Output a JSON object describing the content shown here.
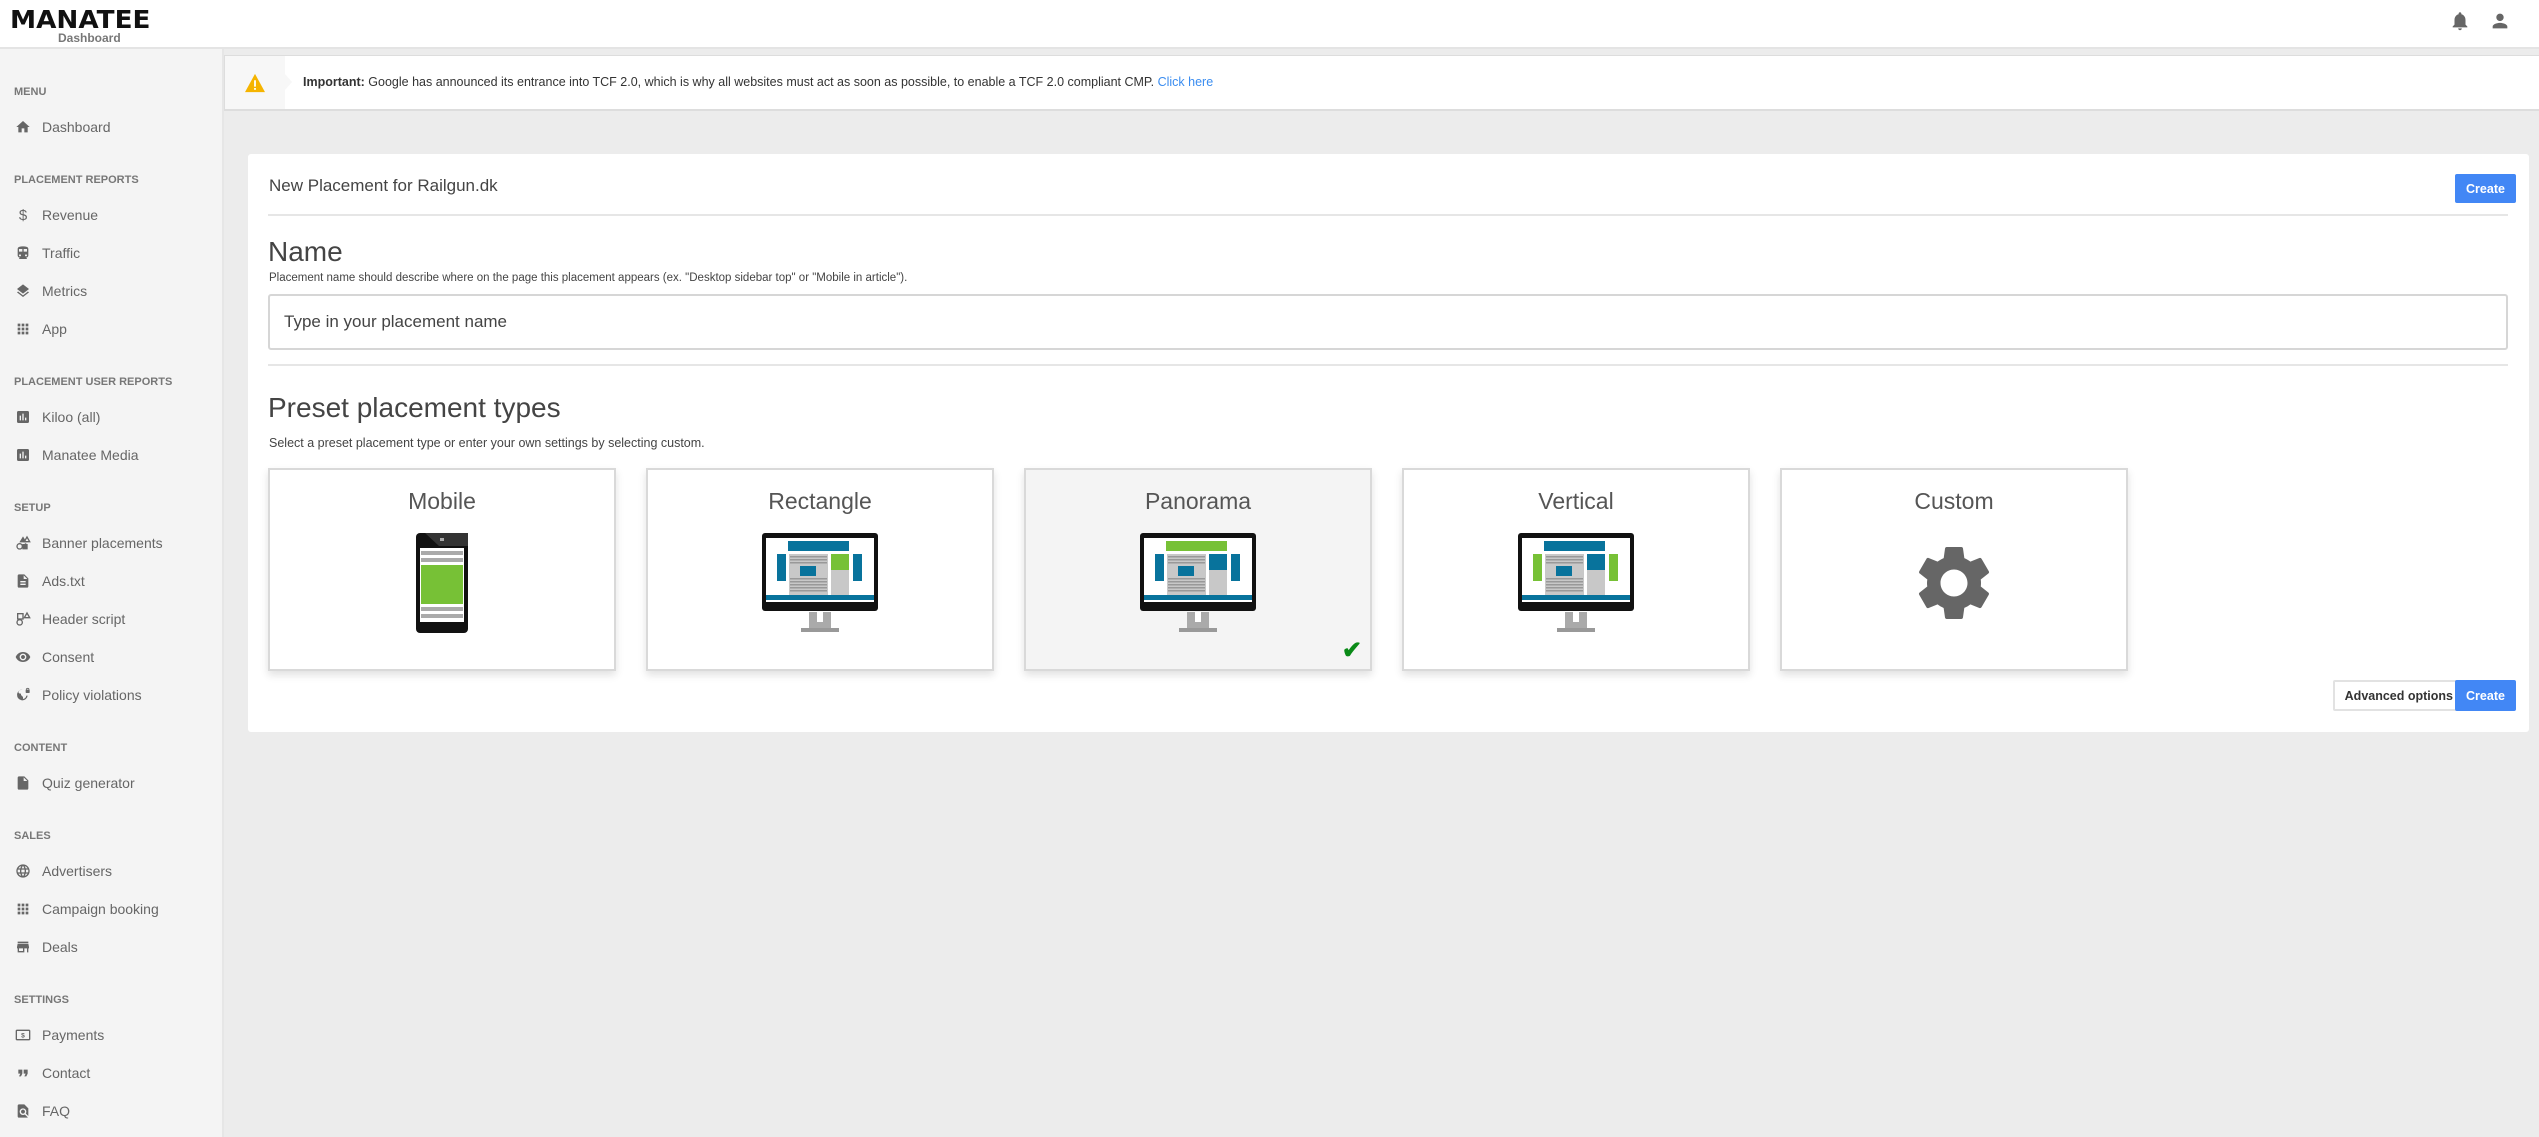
{
  "header": {
    "logo_main": "MANATEE",
    "logo_sub": "Dashboard",
    "icons": [
      "bell-icon",
      "user-icon"
    ]
  },
  "sidebar": {
    "sections": [
      {
        "title": "MENU",
        "items": [
          {
            "label": "Dashboard",
            "icon": "home-icon"
          }
        ]
      },
      {
        "title": "PLACEMENT REPORTS",
        "items": [
          {
            "label": "Revenue",
            "icon": "dollar-icon"
          },
          {
            "label": "Traffic",
            "icon": "train-icon"
          },
          {
            "label": "Metrics",
            "icon": "layers-icon"
          },
          {
            "label": "App",
            "icon": "apps-grid-icon"
          }
        ]
      },
      {
        "title": "PLACEMENT USER REPORTS",
        "items": [
          {
            "label": "Kiloo (all)",
            "icon": "bar-chart-icon"
          },
          {
            "label": "Manatee Media",
            "icon": "bar-chart-icon"
          }
        ]
      },
      {
        "title": "SETUP",
        "items": [
          {
            "label": "Banner placements",
            "icon": "shapes-icon"
          },
          {
            "label": "Ads.txt",
            "icon": "document-icon"
          },
          {
            "label": "Header script",
            "icon": "shapes-icon"
          },
          {
            "label": "Consent",
            "icon": "eye-icon"
          },
          {
            "label": "Policy violations",
            "icon": "globe-lock-icon"
          }
        ]
      },
      {
        "title": "CONTENT",
        "items": [
          {
            "label": "Quiz generator",
            "icon": "file-icon"
          }
        ]
      },
      {
        "title": "SALES",
        "items": [
          {
            "label": "Advertisers",
            "icon": "globe-icon"
          },
          {
            "label": "Campaign booking",
            "icon": "apps-grid-icon"
          },
          {
            "label": "Deals",
            "icon": "store-icon"
          }
        ]
      },
      {
        "title": "SETTINGS",
        "items": [
          {
            "label": "Payments",
            "icon": "payments-icon"
          },
          {
            "label": "Contact",
            "icon": "quote-icon"
          },
          {
            "label": "FAQ",
            "icon": "find-in-page-icon"
          }
        ]
      }
    ]
  },
  "alert": {
    "icon": "warning-icon",
    "bold": "Important:",
    "text": " Google has announced its entrance into TCF 2.0, which is why all websites must act as soon as possible, to enable a TCF 2.0 compliant CMP. ",
    "link": "Click here",
    "icon_color": "#f5b400"
  },
  "form": {
    "title": "New Placement for Railgun.dk",
    "create_label": "Create",
    "name_heading": "Name",
    "name_help": "Placement name should describe where on the page this placement appears (ex. \"Desktop sidebar top\" or \"Mobile in article\").",
    "name_value": "",
    "name_placeholder": "Type in your placement name",
    "preset_heading": "Preset placement types",
    "preset_help": "Select a preset placement type or enter your own settings by selecting custom.",
    "presets": [
      {
        "label": "Mobile",
        "illustration": "mobile-phone-icon",
        "selected": false
      },
      {
        "label": "Rectangle",
        "illustration": "desktop-rectangle-icon",
        "selected": false
      },
      {
        "label": "Panorama",
        "illustration": "desktop-panorama-icon",
        "selected": true
      },
      {
        "label": "Vertical",
        "illustration": "desktop-vertical-icon",
        "selected": false
      },
      {
        "label": "Custom",
        "illustration": "gear-icon",
        "selected": false
      }
    ],
    "check_mark": "✔",
    "advanced_label": "Advanced options",
    "create_bottom_label": "Create",
    "accent_color": "#4287f5",
    "highlight_color": "#77c136",
    "ad_blue": "#08739c"
  }
}
